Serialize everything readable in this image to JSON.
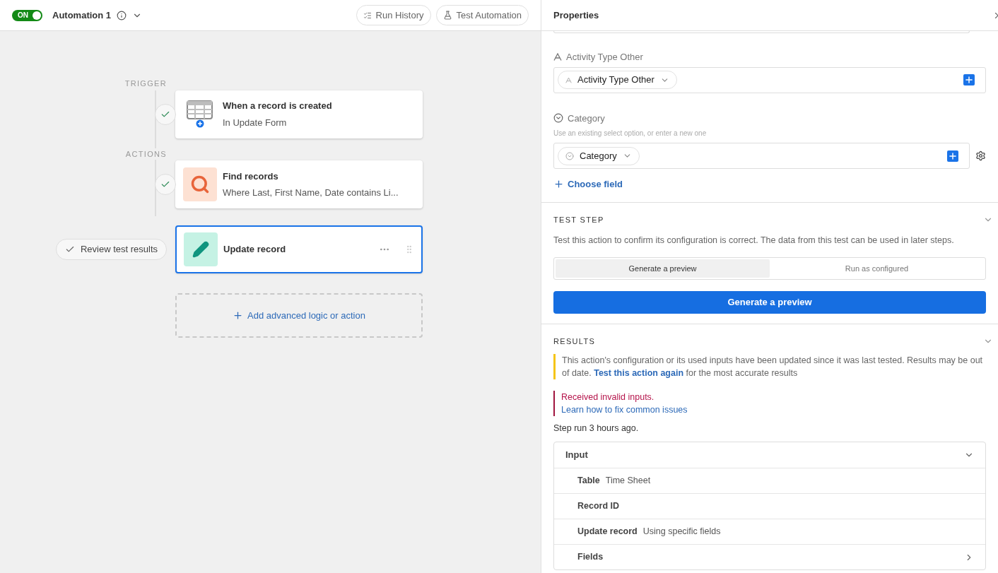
{
  "header": {
    "toggle": {
      "label": "ON",
      "on": true
    },
    "title": "Automation 1",
    "buttons": [
      {
        "kind": "history",
        "label": "Run History"
      },
      {
        "kind": "test",
        "label": "Test Automation"
      }
    ]
  },
  "flow": {
    "trigger_label": "TRIGGER",
    "actions_label": "ACTIONS",
    "add_button": "Add advanced logic or action",
    "steps": [
      {
        "kind": "table",
        "title": "When a record is created",
        "subtitle": "In Update Form",
        "checked": true,
        "selected": false
      },
      {
        "kind": "search",
        "title": "Find records",
        "subtitle": "Where Last, First Name, Date contains Li...",
        "checked": true,
        "selected": false
      },
      {
        "kind": "edit",
        "title": "Update record",
        "selected": true,
        "review_button": "Review test results"
      }
    ]
  },
  "properties": {
    "title": "Properties",
    "fields": [
      {
        "kind": "text",
        "label": "Activity Type Other",
        "token": "Activity Type Other"
      },
      {
        "kind": "select",
        "label": "Category",
        "hint": "Use an existing select option, or enter a new one",
        "token": "Category"
      }
    ],
    "choose_field": "Choose field",
    "test_step": {
      "title": "TEST STEP",
      "description": "Test this action to confirm its configuration is correct. The data from this test can be used in later steps.",
      "modes": [
        {
          "label": "Generate a preview",
          "selected": true
        },
        {
          "label": "Run as configured",
          "selected": false
        }
      ],
      "button": "Generate a preview"
    },
    "results": {
      "title": "RESULTS",
      "warning": {
        "text": "This action's configuration or its used inputs have been updated since it was last tested. Results may be out of date.",
        "link": "Test this action again",
        "after": "for the most accurate results"
      },
      "error": {
        "message": "Received invalid inputs.",
        "link": "Learn how to fix common issues"
      },
      "step_run": "Step run 3 hours ago.",
      "input": {
        "title": "Input",
        "expanded": true,
        "rows": [
          {
            "label": "Table",
            "value": "Time Sheet"
          },
          {
            "label": "Record ID"
          },
          {
            "label": "Update record",
            "value": "Using specific fields"
          },
          {
            "label": "Fields",
            "kind": "expandable"
          }
        ]
      }
    }
  }
}
